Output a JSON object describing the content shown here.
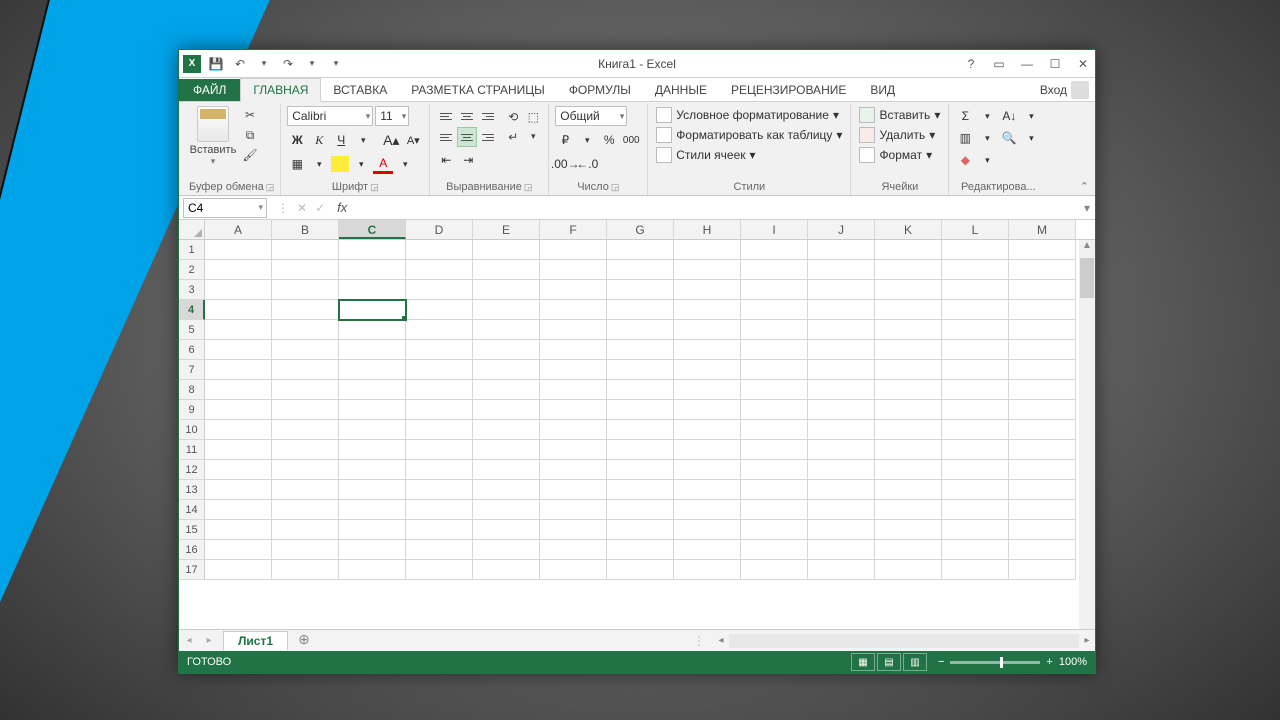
{
  "title": "Книга1 - Excel",
  "qat": {
    "save": "💾",
    "undo": "↶",
    "redo": "↷"
  },
  "tabs": {
    "file": "ФАЙЛ",
    "list": [
      "ГЛАВНАЯ",
      "ВСТАВКА",
      "РАЗМЕТКА СТРАНИЦЫ",
      "ФОРМУЛЫ",
      "ДАННЫЕ",
      "РЕЦЕНЗИРОВАНИЕ",
      "ВИД"
    ],
    "active": 0,
    "signin": "Вход"
  },
  "ribbon": {
    "clipboard": {
      "paste": "Вставить",
      "label": "Буфер обмена"
    },
    "font": {
      "name": "Calibri",
      "size": "11",
      "bold": "Ж",
      "italic": "К",
      "underline": "Ч",
      "label": "Шрифт"
    },
    "align": {
      "label": "Выравнивание"
    },
    "number": {
      "format": "Общий",
      "label": "Число"
    },
    "styles": {
      "cond": "Условное форматирование",
      "table": "Форматировать как таблицу",
      "cell": "Стили ячеек",
      "label": "Стили"
    },
    "cells": {
      "insert": "Вставить",
      "delete": "Удалить",
      "format": "Формат",
      "label": "Ячейки"
    },
    "editing": {
      "label": "Редактирова..."
    }
  },
  "namebox": "C4",
  "fx": "fx",
  "columns": [
    "A",
    "B",
    "C",
    "D",
    "E",
    "F",
    "G",
    "H",
    "I",
    "J",
    "K",
    "L",
    "M"
  ],
  "selected": {
    "col": "C",
    "row": 4
  },
  "rowCount": 17,
  "sheet": "Лист1",
  "status": "ГОТОВО",
  "zoom": "100%"
}
